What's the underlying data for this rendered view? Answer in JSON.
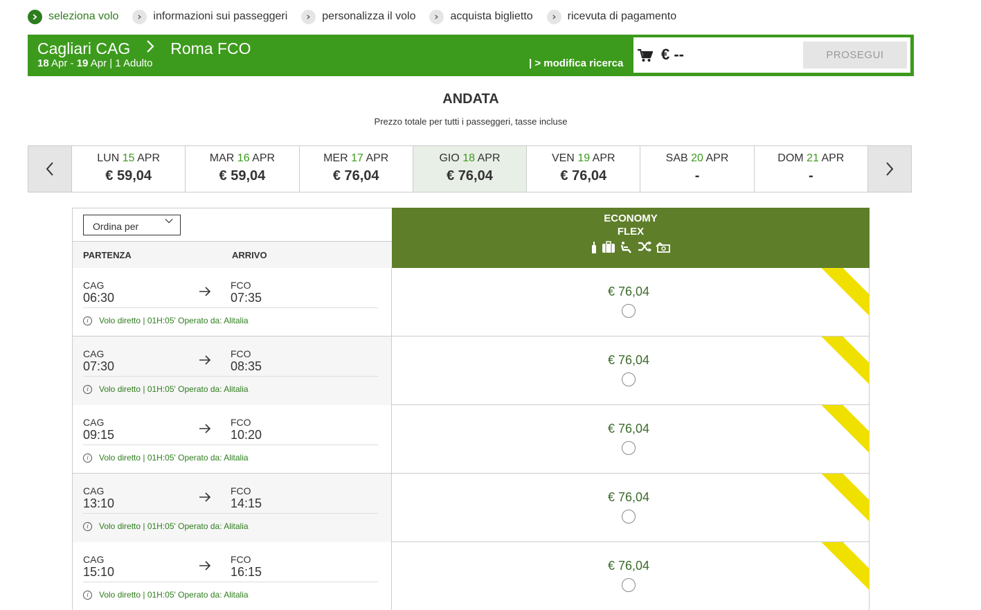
{
  "steps": [
    {
      "label": "seleziona volo",
      "icon": "check-icon",
      "active": true
    },
    {
      "label": "informazioni sui passeggeri",
      "icon": "chevron-right-icon",
      "active": false
    },
    {
      "label": "personalizza il volo",
      "icon": "chevron-right-icon",
      "active": false
    },
    {
      "label": "acquista biglietto",
      "icon": "chevron-right-icon",
      "active": false
    },
    {
      "label": "ricevuta di pagamento",
      "icon": "chevron-right-icon",
      "active": false
    }
  ],
  "header": {
    "origin": "Cagliari CAG",
    "destination": "Roma FCO",
    "date_out": "18",
    "date_out_month": " Apr - ",
    "date_back": "19",
    "date_back_rest": " Apr | 1 Adulto",
    "modify_label": "| > modifica ricerca",
    "total": "€ --",
    "proceed_label": "PROSEGUI",
    "bar_color": "#3c9a1c"
  },
  "section": {
    "title": "ANDATA",
    "subtitle": "Prezzo totale per tutti i passeggeri, tasse incluse"
  },
  "days": [
    {
      "dow": "LUN",
      "num": "15",
      "month": "APR",
      "price": "€ 59,04",
      "selected": false
    },
    {
      "dow": "MAR",
      "num": "16",
      "month": "APR",
      "price": "€ 59,04",
      "selected": false
    },
    {
      "dow": "MER",
      "num": "17",
      "month": "APR",
      "price": "€ 76,04",
      "selected": false
    },
    {
      "dow": "GIO",
      "num": "18",
      "month": "APR",
      "price": "€ 76,04",
      "selected": true
    },
    {
      "dow": "VEN",
      "num": "19",
      "month": "APR",
      "price": "€ 76,04",
      "selected": false
    },
    {
      "dow": "SAB",
      "num": "20",
      "month": "APR",
      "price": "-",
      "selected": false
    },
    {
      "dow": "DOM",
      "num": "21",
      "month": "APR",
      "price": "-",
      "selected": false
    }
  ],
  "table": {
    "sort_label": "Ordina per",
    "col_departure": "PARTENZA",
    "col_arrival": "ARRIVO",
    "fare_line1": "ECONOMY",
    "fare_line2": "FLEX",
    "fare_icons": [
      "hand-baggage-icon",
      "checked-baggage-icon",
      "seat-icon",
      "change-icon",
      "refund-icon"
    ],
    "fare_color": "#5e7e2a"
  },
  "flights": [
    {
      "dep_code": "CAG",
      "dep_time": "06:30",
      "arr_code": "FCO",
      "arr_time": "07:35",
      "info": "Volo diretto | 01H:05' Operato da: Alitalia",
      "price": "€ 76,04"
    },
    {
      "dep_code": "CAG",
      "dep_time": "07:30",
      "arr_code": "FCO",
      "arr_time": "08:35",
      "info": "Volo diretto | 01H:05' Operato da: Alitalia",
      "price": "€ 76,04"
    },
    {
      "dep_code": "CAG",
      "dep_time": "09:15",
      "arr_code": "FCO",
      "arr_time": "10:20",
      "info": "Volo diretto | 01H:05' Operato da: Alitalia",
      "price": "€ 76,04"
    },
    {
      "dep_code": "CAG",
      "dep_time": "13:10",
      "arr_code": "FCO",
      "arr_time": "14:15",
      "info": "Volo diretto | 01H:05' Operato da: Alitalia",
      "price": "€ 76,04"
    },
    {
      "dep_code": "CAG",
      "dep_time": "15:10",
      "arr_code": "FCO",
      "arr_time": "16:15",
      "info": "Volo diretto | 01H:05' Operato da: Alitalia",
      "price": "€ 76,04"
    }
  ]
}
